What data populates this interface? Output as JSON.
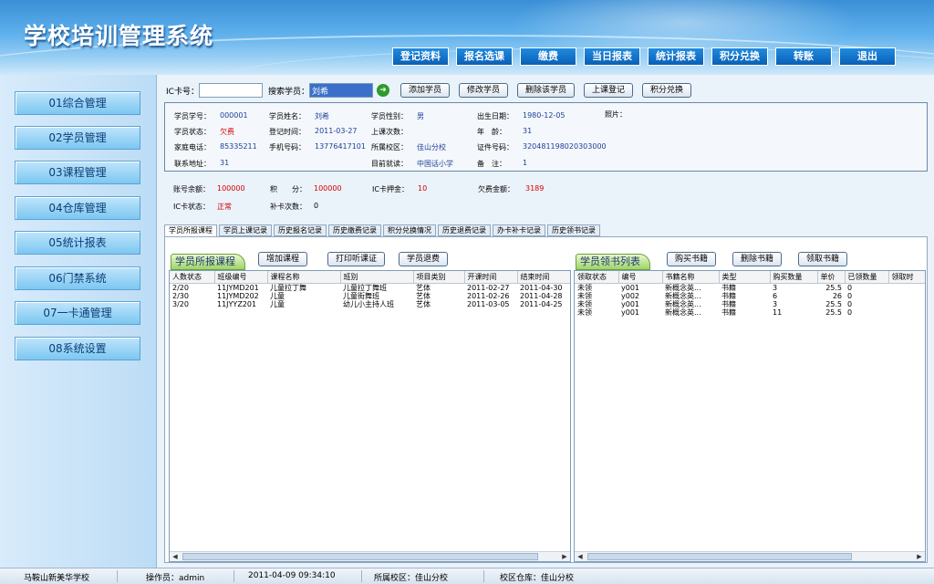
{
  "app": {
    "title": "学校培训管理系统"
  },
  "topnav": [
    "登记资料",
    "报名选课",
    "缴费",
    "当日报表",
    "统计报表",
    "积分兑换",
    "转账",
    "退出"
  ],
  "sidebar": [
    "01综合管理",
    "02学员管理",
    "03课程管理",
    "04仓库管理",
    "05统计报表",
    "06门禁系统",
    "07一卡通管理",
    "08系统设置"
  ],
  "toolbar": {
    "ic_label": "IC卡号：",
    "ic_value": "",
    "search_label": "搜索学员：",
    "search_value": "刘希",
    "add_student": "添加学员",
    "edit_student": "修改学员",
    "delete_student": "删除该学员",
    "checkin": "上课登记",
    "points_exchange": "积分兑换"
  },
  "student": {
    "id_label": "学员学号：",
    "id": "000001",
    "name_label": "学员姓名：",
    "name": "刘希",
    "gender_label": "学员性别：",
    "gender": "男",
    "dob_label": "出生日期：",
    "dob": "1980-12-05",
    "photo_label": "照片：",
    "status_label": "学员状态：",
    "status": "欠费",
    "regtime_label": "登记时间：",
    "regtime": "2011-03-27",
    "classes_label": "上课次数：",
    "classes": "",
    "age_label": "年　龄：",
    "age": "31",
    "phone_label": "家庭电话：",
    "phone": "85335211",
    "mobile_label": "手机号码：",
    "mobile": "13776417101",
    "campus_label": "所属校区：",
    "campus": "佳山分校",
    "idcard_label": "证件号码：",
    "idcard": "320481198020303000",
    "address_label": "联系地址：",
    "address": "31",
    "school_label": "目前就读：",
    "school": "中国话小学",
    "remark_label": "备　注：",
    "remark": "1"
  },
  "account": {
    "balance_label": "账号余额：",
    "balance": "100000",
    "points_label": "积　　分：",
    "points": "100000",
    "deposit_label": "IC卡押金：",
    "deposit": "10",
    "owed_label": "欠费金额：",
    "owed": "3189",
    "card_status_label": "IC卡状态：",
    "card_status": "正常",
    "reissue_label": "补卡次数：",
    "reissue": "0"
  },
  "tabs": [
    "学员所报课程",
    "学员上课记录",
    "历史报名记录",
    "历史缴费记录",
    "积分兑换情况",
    "历史退费记录",
    "办卡补卡记录",
    "历史领书记录"
  ],
  "courses": {
    "panel_title": "学员所报课程",
    "buttons": {
      "add": "增加课程",
      "print": "打印听课证",
      "refund": "学员退费"
    },
    "columns": [
      "人数状态",
      "班级编号",
      "课程名称",
      "班别",
      "项目类别",
      "开课时间",
      "结束时间"
    ],
    "rows": [
      [
        "2/20",
        "11JYMD201",
        "儿童拉丁舞",
        "儿童拉丁舞班",
        "艺体",
        "2011-02-27",
        "2011-04-30"
      ],
      [
        "2/30",
        "11JYMD202",
        "儿童",
        "儿童街舞班",
        "艺体",
        "2011-02-26",
        "2011-04-28"
      ],
      [
        "3/20",
        "11JYYZ201",
        "儿童",
        "幼儿小主持人班",
        "艺体",
        "2011-03-05",
        "2011-04-25"
      ]
    ]
  },
  "books": {
    "panel_title": "学员领书列表",
    "buttons": {
      "buy": "购买书籍",
      "delete": "删除书籍",
      "receive": "领取书籍"
    },
    "columns": [
      "领取状态",
      "编号",
      "书籍名称",
      "类型",
      "购买数量",
      "单价",
      "已领数量",
      "领取时"
    ],
    "rows": [
      [
        "未领",
        "y001",
        "新概念英...",
        "书籍",
        "3",
        "25.5",
        "0",
        ""
      ],
      [
        "未领",
        "y002",
        "新概念英...",
        "书籍",
        "6",
        "26",
        "0",
        ""
      ],
      [
        "未领",
        "y001",
        "新概念英...",
        "书籍",
        "3",
        "25.5",
        "0",
        ""
      ],
      [
        "未领",
        "y001",
        "新概念英...",
        "书籍",
        "11",
        "25.5",
        "0",
        ""
      ]
    ]
  },
  "statusbar": {
    "school": "马鞍山新美华学校",
    "operator": "操作员：admin",
    "datetime": "2011-04-09 09:34:10",
    "campus": "所属校区：佳山分校",
    "warehouse": "校区仓库：佳山分校"
  }
}
